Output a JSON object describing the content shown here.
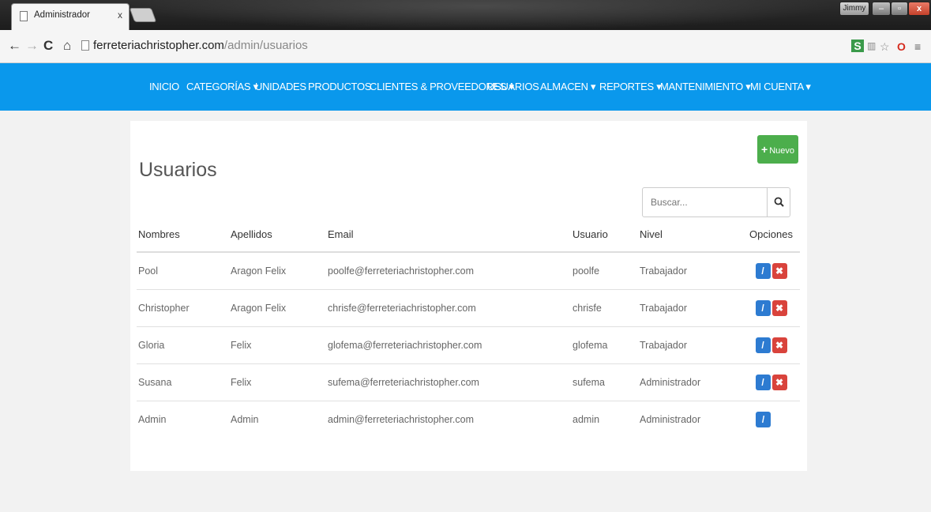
{
  "browser": {
    "tab_title": "Administrador",
    "tab_close": "x",
    "window_user": "Jimmy",
    "window_min": "–",
    "window_max": "▫",
    "window_close": "x",
    "url_host": "ferreteriachristopher.com",
    "url_path": "/admin/usuarios",
    "ext_s": "S",
    "ext_translate": "▥",
    "ext_star": "☆",
    "ext_opera": "O",
    "ext_menu": "≡"
  },
  "nav": {
    "items": [
      {
        "label": "INICIO"
      },
      {
        "label": "CATEGORÍAS ▾"
      },
      {
        "label": "UNIDADES"
      },
      {
        "label": "PRODUCTOS"
      },
      {
        "label": "CLIENTES & PROVEEDORES ▾"
      },
      {
        "label": "USUARIOS"
      },
      {
        "label": "ALMACEN ▾"
      },
      {
        "label": "REPORTES ▾"
      },
      {
        "label": "MANTENIMIENTO ▾"
      },
      {
        "label": "MI CUENTA ▾"
      }
    ]
  },
  "page": {
    "title": "Usuarios",
    "new_button": "Nuevo",
    "search_placeholder": "Buscar..."
  },
  "table": {
    "headers": [
      "Nombres",
      "Apellidos",
      "Email",
      "Usuario",
      "Nivel",
      "Opciones"
    ],
    "rows": [
      {
        "nombres": "Pool",
        "apellidos": "Aragon Felix",
        "email": "poolfe@ferreteriachristopher.com",
        "usuario": "poolfe",
        "nivel": "Trabajador",
        "can_delete": true
      },
      {
        "nombres": "Christopher",
        "apellidos": "Aragon Felix",
        "email": "chrisfe@ferreteriachristopher.com",
        "usuario": "chrisfe",
        "nivel": "Trabajador",
        "can_delete": true
      },
      {
        "nombres": "Gloria",
        "apellidos": "Felix",
        "email": "glofema@ferreteriachristopher.com",
        "usuario": "glofema",
        "nivel": "Trabajador",
        "can_delete": true
      },
      {
        "nombres": "Susana",
        "apellidos": "Felix",
        "email": "sufema@ferreteriachristopher.com",
        "usuario": "sufema",
        "nivel": "Administrador",
        "can_delete": true
      },
      {
        "nombres": "Admin",
        "apellidos": "Admin",
        "email": "admin@ferreteriachristopher.com",
        "usuario": "admin",
        "nivel": "Administrador",
        "can_delete": false
      }
    ]
  },
  "colors": {
    "nav_bg": "#0a98ec",
    "new_button": "#4cae4c",
    "edit_button": "#2d7bd1",
    "delete_button": "#d9433c"
  }
}
